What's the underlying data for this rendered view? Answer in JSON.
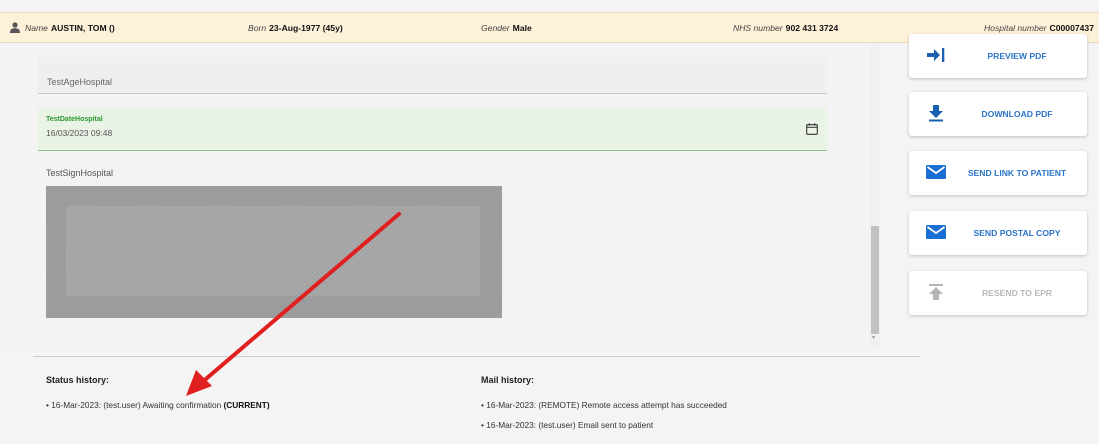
{
  "patient_bar": {
    "name_label": "Name",
    "name_value": "AUSTIN, TOM ()",
    "born_label": "Born",
    "born_value": "23-Aug-1977 (45y)",
    "gender_label": "Gender",
    "gender_value": "Male",
    "nhs_label": "NHS number",
    "nhs_value": "902 431 3724",
    "hospital_label": "Hospital number",
    "hospital_value": "C00007437"
  },
  "form": {
    "age_field_label": "TestAgeHospital",
    "date_field_label": "TestDateHospital",
    "date_field_value": "16/03/2023 09:48",
    "sign_field_label": "TestSignHospital"
  },
  "actions": {
    "preview_pdf": "PREVIEW PDF",
    "download_pdf": "DOWNLOAD PDF",
    "send_link": "SEND LINK TO PATIENT",
    "send_postal": "SEND POSTAL COPY",
    "resend_epr": "RESEND TO EPR"
  },
  "status_history": {
    "title": "Status history:",
    "items": [
      {
        "prefix": "• 16-Mar-2023: (test.user) Awaiting confirmation ",
        "bold": "(CURRENT)"
      }
    ]
  },
  "mail_history": {
    "title": "Mail history:",
    "items": [
      "• 16-Mar-2023: (REMOTE) Remote access attempt has succeeded",
      "• 16-Mar-2023: (test.user) Email sent to patient"
    ]
  },
  "colors": {
    "accent": "#2b74c7",
    "annotation_arrow": "#e02020",
    "patient_bar_bg": "#fdf1d9",
    "date_field_bg": "#e9f3e6"
  }
}
